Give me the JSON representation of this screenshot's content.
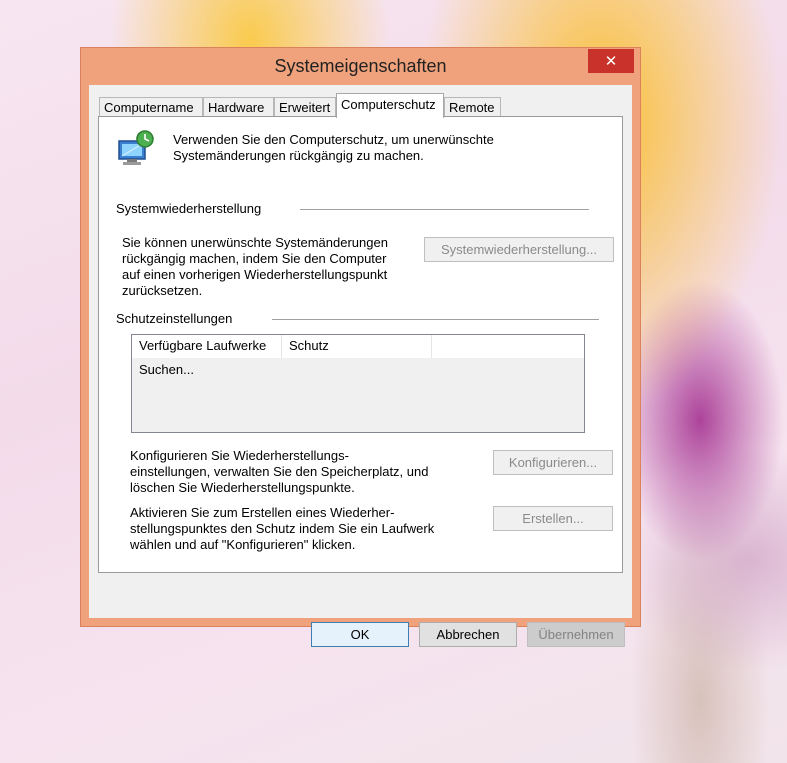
{
  "window": {
    "title": "Systemeigenschaften",
    "close_glyph": "✕"
  },
  "tabs": [
    {
      "label": "Computername",
      "active": false
    },
    {
      "label": "Hardware",
      "active": false
    },
    {
      "label": "Erweitert",
      "active": false
    },
    {
      "label": "Computerschutz",
      "active": true
    },
    {
      "label": "Remote",
      "active": false
    }
  ],
  "intro": {
    "icon": "system-protection-icon",
    "line1": "Verwenden Sie den Computerschutz, um unerwünschte",
    "line2": "Systemänderungen rückgängig zu machen."
  },
  "restore_group": {
    "title": "Systemwiederherstellung",
    "text_lines": [
      "Sie können unerwünschte Systemänderungen",
      "rückgängig machen, indem Sie den Computer",
      "auf einen vorherigen Wiederherstellungspunkt",
      "zurücksetzen."
    ],
    "button": "Systemwiederherstellung..."
  },
  "protection_group": {
    "title": "Schutzeinstellungen",
    "columns": [
      "Verfügbare Laufwerke",
      "Schutz"
    ],
    "rows": [
      "Suchen..."
    ],
    "configure_text_lines": [
      "Konfigurieren Sie Wiederherstellungs-",
      "einstellungen, verwalten Sie den Speicherplatz, und",
      "löschen Sie Wiederherstellungspunkte."
    ],
    "configure_button": "Konfigurieren...",
    "create_text_lines": [
      "Aktivieren Sie zum Erstellen eines Wiederher-",
      "stellungspunktes den Schutz indem Sie ein Laufwerk",
      "wählen und auf \"Konfigurieren\" klicken."
    ],
    "create_button": "Erstellen..."
  },
  "footer": {
    "ok": "OK",
    "cancel": "Abbrechen",
    "apply": "Übernehmen"
  },
  "colors": {
    "frame": "#f0a27c",
    "close": "#c8322a",
    "client": "#f0f0f0"
  }
}
